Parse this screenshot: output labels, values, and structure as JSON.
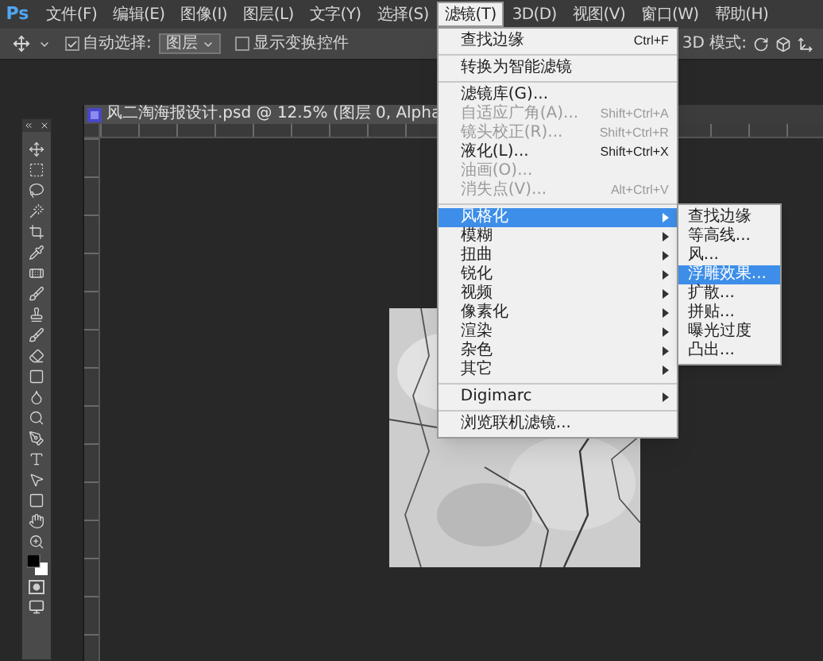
{
  "menu_bar": {
    "logo": "Ps",
    "items": [
      {
        "label": "文件(F)",
        "selected": false
      },
      {
        "label": "编辑(E)",
        "selected": false
      },
      {
        "label": "图像(I)",
        "selected": false
      },
      {
        "label": "图层(L)",
        "selected": false
      },
      {
        "label": "文字(Y)",
        "selected": false
      },
      {
        "label": "选择(S)",
        "selected": false
      },
      {
        "label": "滤镜(T)",
        "selected": true
      },
      {
        "label": "3D(D)",
        "selected": false
      },
      {
        "label": "视图(V)",
        "selected": false
      },
      {
        "label": "窗口(W)",
        "selected": false
      },
      {
        "label": "帮助(H)",
        "selected": false
      }
    ]
  },
  "options_bar": {
    "auto_select": {
      "label": "自动选择:",
      "checked": true
    },
    "target": "图层",
    "show_transform": {
      "label": "显示变换控件",
      "checked": false
    },
    "mode_label": "3D 模式:"
  },
  "document": {
    "title": "风二淘海报设计.psd @ 12.5% (图层 0, Alpha"
  },
  "filter_menu": {
    "groups": [
      {
        "items": [
          {
            "label": "查找边缘",
            "shortcut": "Ctrl+F",
            "disabled": false,
            "submenu": false,
            "selected": false
          }
        ]
      },
      {
        "items": [
          {
            "label": "转换为智能滤镜",
            "disabled": false,
            "submenu": false,
            "selected": false
          }
        ]
      },
      {
        "items": [
          {
            "label": "滤镜库(G)...",
            "disabled": false,
            "submenu": false,
            "selected": false
          },
          {
            "label": "自适应广角(A)...",
            "shortcut": "Shift+Ctrl+A",
            "disabled": true,
            "submenu": false,
            "selected": false
          },
          {
            "label": "镜头校正(R)...",
            "shortcut": "Shift+Ctrl+R",
            "disabled": true,
            "submenu": false,
            "selected": false
          },
          {
            "label": "液化(L)...",
            "shortcut": "Shift+Ctrl+X",
            "disabled": false,
            "submenu": false,
            "selected": false
          },
          {
            "label": "油画(O)...",
            "disabled": true,
            "submenu": false,
            "selected": false
          },
          {
            "label": "消失点(V)...",
            "shortcut": "Alt+Ctrl+V",
            "disabled": true,
            "submenu": false,
            "selected": false
          }
        ]
      },
      {
        "items": [
          {
            "label": "风格化",
            "disabled": false,
            "submenu": true,
            "selected": true,
            "children": [
              {
                "label": "查找边缘",
                "selected": false
              },
              {
                "label": "等高线...",
                "selected": false
              },
              {
                "label": "风...",
                "selected": false
              },
              {
                "label": "浮雕效果...",
                "selected": true
              },
              {
                "label": "扩散...",
                "selected": false
              },
              {
                "label": "拼贴...",
                "selected": false
              },
              {
                "label": "曝光过度",
                "selected": false
              },
              {
                "label": "凸出...",
                "selected": false
              }
            ]
          },
          {
            "label": "模糊",
            "disabled": false,
            "submenu": true,
            "selected": false
          },
          {
            "label": "扭曲",
            "disabled": false,
            "submenu": true,
            "selected": false
          },
          {
            "label": "锐化",
            "disabled": false,
            "submenu": true,
            "selected": false
          },
          {
            "label": "视频",
            "disabled": false,
            "submenu": true,
            "selected": false
          },
          {
            "label": "像素化",
            "disabled": false,
            "submenu": true,
            "selected": false
          },
          {
            "label": "渲染",
            "disabled": false,
            "submenu": true,
            "selected": false
          },
          {
            "label": "杂色",
            "disabled": false,
            "submenu": true,
            "selected": false
          },
          {
            "label": "其它",
            "disabled": false,
            "submenu": true,
            "selected": false
          }
        ]
      },
      {
        "items": [
          {
            "label": "Digimarc",
            "disabled": false,
            "submenu": true,
            "selected": false
          }
        ]
      },
      {
        "items": [
          {
            "label": "浏览联机滤镜...",
            "disabled": false,
            "submenu": false,
            "selected": false
          }
        ]
      }
    ]
  }
}
